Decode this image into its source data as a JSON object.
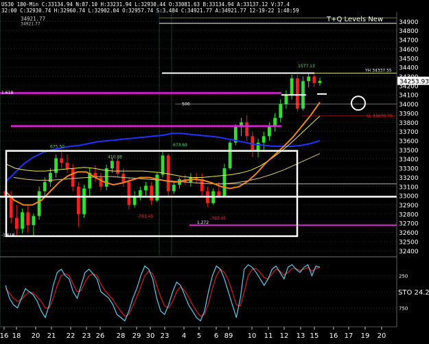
{
  "header": {
    "symbol": "US30",
    "timeframe": "180-Min",
    "line1": "C:33134.94 N:87.10 H:33231.94 L:32930.44 O:33081.63 B:33134.94 A:33137.12 V:37.4",
    "line2": "32:00 C:32930.74 H:32960.74 L:32902.04 O:32957.74 S:3.484 C:34921.77 A:34921.77 12-19-22 1:48:59",
    "sub": "34921.77"
  },
  "watermark": "T+Q Levels New",
  "colors": {
    "background": "#000000",
    "up_candle": "#33dd33",
    "down_candle": "#ee2222",
    "sma_blue": "#2233ff",
    "ema_orange": "#ee8822",
    "ema_yellow": "#eeee55",
    "magenta": "#dd22dd",
    "sto_cyan": "#66ccee",
    "sto_red": "#cc2222"
  },
  "chart_data": [
    {
      "type": "candlestick",
      "title": "US30 180-Min",
      "ylim": [
        32350,
        35000
      ],
      "y_ticks": [
        32400,
        32500,
        32600,
        32700,
        32800,
        32900,
        33000,
        33100,
        33200,
        33300,
        33400,
        33500,
        33600,
        33700,
        33800,
        33900,
        34000,
        34100,
        34200,
        34300,
        34400,
        34500,
        34600,
        34700,
        34800,
        34900
      ],
      "last_price": "34253.93",
      "x_labels": [
        "16",
        "18",
        "20",
        "21",
        "22",
        "23",
        "26",
        "28",
        "29",
        "30",
        "23",
        "4",
        "5",
        "6",
        "89",
        "10",
        "11",
        "12",
        "13",
        "15",
        "16",
        "17",
        "19",
        "20"
      ],
      "candles": [
        {
          "o": 33050,
          "h": 33120,
          "l": 32960,
          "c": 33000
        },
        {
          "o": 33000,
          "h": 33050,
          "l": 32700,
          "c": 32760
        },
        {
          "o": 32760,
          "h": 32900,
          "l": 32560,
          "c": 32640
        },
        {
          "o": 32640,
          "h": 32860,
          "l": 32590,
          "c": 32820
        },
        {
          "o": 32820,
          "h": 32900,
          "l": 32600,
          "c": 32680
        },
        {
          "o": 32680,
          "h": 32810,
          "l": 32560,
          "c": 32780
        },
        {
          "o": 32780,
          "h": 33100,
          "l": 32740,
          "c": 33050
        },
        {
          "o": 33050,
          "h": 33200,
          "l": 32980,
          "c": 33150
        },
        {
          "o": 33150,
          "h": 33300,
          "l": 33100,
          "c": 33250
        },
        {
          "o": 33250,
          "h": 33450,
          "l": 33200,
          "c": 33410
        },
        {
          "o": 33410,
          "h": 33480,
          "l": 33300,
          "c": 33360
        },
        {
          "o": 33360,
          "h": 33450,
          "l": 33250,
          "c": 33300
        },
        {
          "o": 33300,
          "h": 33350,
          "l": 33050,
          "c": 33100
        },
        {
          "o": 33100,
          "h": 33150,
          "l": 32660,
          "c": 32800
        },
        {
          "o": 32800,
          "h": 33120,
          "l": 32760,
          "c": 33080
        },
        {
          "o": 33080,
          "h": 33300,
          "l": 33000,
          "c": 33250
        },
        {
          "o": 33250,
          "h": 33330,
          "l": 33150,
          "c": 33200
        },
        {
          "o": 33200,
          "h": 33250,
          "l": 33060,
          "c": 33100
        },
        {
          "o": 33100,
          "h": 33340,
          "l": 33060,
          "c": 33300
        },
        {
          "o": 33300,
          "h": 33420,
          "l": 33250,
          "c": 33380
        },
        {
          "o": 33380,
          "h": 33410,
          "l": 33200,
          "c": 33240
        },
        {
          "o": 33240,
          "h": 33300,
          "l": 33100,
          "c": 33150
        },
        {
          "o": 33150,
          "h": 33200,
          "l": 32850,
          "c": 32900
        },
        {
          "o": 32900,
          "h": 33050,
          "l": 32870,
          "c": 33000
        },
        {
          "o": 33000,
          "h": 33100,
          "l": 32950,
          "c": 33060
        },
        {
          "o": 33060,
          "h": 33150,
          "l": 33000,
          "c": 33110
        },
        {
          "o": 33110,
          "h": 33150,
          "l": 32900,
          "c": 32950
        },
        {
          "o": 32950,
          "h": 33250,
          "l": 32930,
          "c": 33230
        },
        {
          "o": 33230,
          "h": 33480,
          "l": 33200,
          "c": 33440
        },
        {
          "o": 33440,
          "h": 33460,
          "l": 33000,
          "c": 33050
        },
        {
          "o": 33050,
          "h": 33150,
          "l": 33020,
          "c": 33120
        },
        {
          "o": 33120,
          "h": 33200,
          "l": 33080,
          "c": 33180
        },
        {
          "o": 33180,
          "h": 33230,
          "l": 33120,
          "c": 33150
        },
        {
          "o": 33150,
          "h": 33250,
          "l": 33100,
          "c": 33200
        },
        {
          "o": 33200,
          "h": 33250,
          "l": 33130,
          "c": 33180
        },
        {
          "o": 33180,
          "h": 33240,
          "l": 33000,
          "c": 33050
        },
        {
          "o": 33050,
          "h": 33100,
          "l": 32880,
          "c": 32920
        },
        {
          "o": 32920,
          "h": 33080,
          "l": 32900,
          "c": 33050
        },
        {
          "o": 33050,
          "h": 33150,
          "l": 32980,
          "c": 33000
        },
        {
          "o": 33000,
          "h": 33350,
          "l": 32990,
          "c": 33300
        },
        {
          "o": 33300,
          "h": 33600,
          "l": 33280,
          "c": 33580
        },
        {
          "o": 33580,
          "h": 33780,
          "l": 33550,
          "c": 33750
        },
        {
          "o": 33750,
          "h": 33850,
          "l": 33650,
          "c": 33800
        },
        {
          "o": 33800,
          "h": 33880,
          "l": 33600,
          "c": 33650
        },
        {
          "o": 33650,
          "h": 33700,
          "l": 33420,
          "c": 33480
        },
        {
          "o": 33480,
          "h": 33620,
          "l": 33420,
          "c": 33580
        },
        {
          "o": 33580,
          "h": 33700,
          "l": 33500,
          "c": 33650
        },
        {
          "o": 33650,
          "h": 33800,
          "l": 33600,
          "c": 33760
        },
        {
          "o": 33760,
          "h": 33900,
          "l": 33700,
          "c": 33850
        },
        {
          "o": 33850,
          "h": 34050,
          "l": 33800,
          "c": 34000
        },
        {
          "o": 34000,
          "h": 34150,
          "l": 33950,
          "c": 34100
        },
        {
          "o": 34100,
          "h": 34320,
          "l": 34050,
          "c": 34280
        },
        {
          "o": 34280,
          "h": 34320,
          "l": 33920,
          "c": 33950
        },
        {
          "o": 33950,
          "h": 34300,
          "l": 33930,
          "c": 34250
        },
        {
          "o": 34250,
          "h": 34330,
          "l": 34180,
          "c": 34300
        },
        {
          "o": 34300,
          "h": 34320,
          "l": 34190,
          "c": 34230
        },
        {
          "o": 34230,
          "h": 34290,
          "l": 34200,
          "c": 34254
        }
      ],
      "sma_blue": [
        33150,
        33250,
        33350,
        33420,
        33470,
        33500,
        33520,
        33540,
        33550,
        33570,
        33590,
        33600,
        33610,
        33620,
        33630,
        33640,
        33650,
        33660,
        33680,
        33680,
        33670,
        33660,
        33650,
        33640,
        33620,
        33600,
        33580,
        33560,
        33550,
        33540,
        33540,
        33540,
        33550,
        33570,
        33600
      ],
      "ema_orange": [
        33050,
        32950,
        32900,
        32900,
        32950,
        33050,
        33150,
        33220,
        33260,
        33260,
        33200,
        33150,
        33120,
        33140,
        33170,
        33200,
        33200,
        33180,
        33160,
        33150,
        33170,
        33180,
        33170,
        33140,
        33100,
        33080,
        33100,
        33160,
        33250,
        33360,
        33450,
        33540,
        33640,
        33760,
        33880,
        34020
      ],
      "ema_yellow": [
        33350,
        33300,
        33280,
        33270,
        33270,
        33280,
        33290,
        33300,
        33310,
        33300,
        33280,
        33270,
        33270,
        33270,
        33270,
        33260,
        33250,
        33230,
        33210,
        33200,
        33200,
        33210,
        33220,
        33230,
        33250,
        33280,
        33330,
        33400,
        33480,
        33570,
        33670,
        33770,
        33870
      ],
      "ema_yellow_low": [
        33200,
        33180,
        33170,
        33170,
        33180,
        33190,
        33200,
        33210,
        33210,
        33200,
        33190,
        33180,
        33170,
        33160,
        33150,
        33140,
        33130,
        33130,
        33140,
        33160,
        33190,
        33230,
        33280,
        33340,
        33400,
        33460
      ],
      "levels": [
        {
          "price": 34337.55,
          "label": "YH 34337.55",
          "color": "#ffffff"
        },
        {
          "price": 34000,
          "label": "500",
          "color": "#aaaaaa"
        },
        {
          "price": 33870.75,
          "label": "SL 33870.75",
          "color": "#cc2222"
        },
        {
          "price": 33130,
          "label": "",
          "color": "#ffffff"
        },
        {
          "price": 32990,
          "label": "",
          "color": "#ffffff"
        },
        {
          "price": 34120,
          "label": "",
          "color": "#dd22dd"
        },
        {
          "price": 33760,
          "label": "",
          "color": "#dd22dd"
        },
        {
          "price": 32680,
          "label": "1.272",
          "color": "#dd22dd"
        }
      ],
      "annotations": [
        "1577.13",
        "673.69",
        "410.88",
        "675.50",
        "-783.45",
        "-793.45",
        "34921.77",
        "1.618",
        "-1.618"
      ]
    },
    {
      "type": "line",
      "title": "STO",
      "sto_value": "24.2",
      "y_ticks": [
        "250",
        "750"
      ],
      "series": [
        {
          "name": "STO",
          "values": [
            60,
            40,
            30,
            25,
            40,
            55,
            50,
            45,
            35,
            20,
            10,
            30,
            60,
            80,
            85,
            75,
            70,
            50,
            40,
            60,
            80,
            85,
            78,
            70,
            50,
            45,
            40,
            30,
            15,
            10,
            5,
            20,
            40,
            55,
            75,
            90,
            85,
            70,
            40,
            20,
            15,
            30,
            50,
            65,
            60,
            45,
            30,
            20,
            10,
            5,
            20,
            50,
            75,
            90,
            85,
            70,
            50,
            30,
            10,
            40,
            85,
            92,
            88,
            80,
            70,
            60,
            70,
            85,
            90,
            80,
            70,
            88,
            92,
            85,
            80,
            88,
            92,
            75,
            90,
            88
          ]
        },
        {
          "name": "SIG",
          "values": [
            55,
            48,
            40,
            35,
            38,
            45,
            50,
            48,
            42,
            35,
            25,
            25,
            40,
            60,
            75,
            78,
            75,
            62,
            50,
            52,
            65,
            75,
            78,
            75,
            62,
            52,
            45,
            38,
            28,
            20,
            12,
            15,
            28,
            42,
            58,
            75,
            82,
            78,
            60,
            42,
            28,
            25,
            35,
            50,
            58,
            52,
            42,
            30,
            20,
            12,
            15,
            32,
            55,
            75,
            85,
            80,
            68,
            50,
            30,
            28,
            50,
            75,
            85,
            86,
            80,
            72,
            70,
            78,
            85,
            82,
            76,
            80,
            86,
            86,
            83,
            85,
            88,
            82,
            86,
            88
          ]
        }
      ]
    }
  ]
}
